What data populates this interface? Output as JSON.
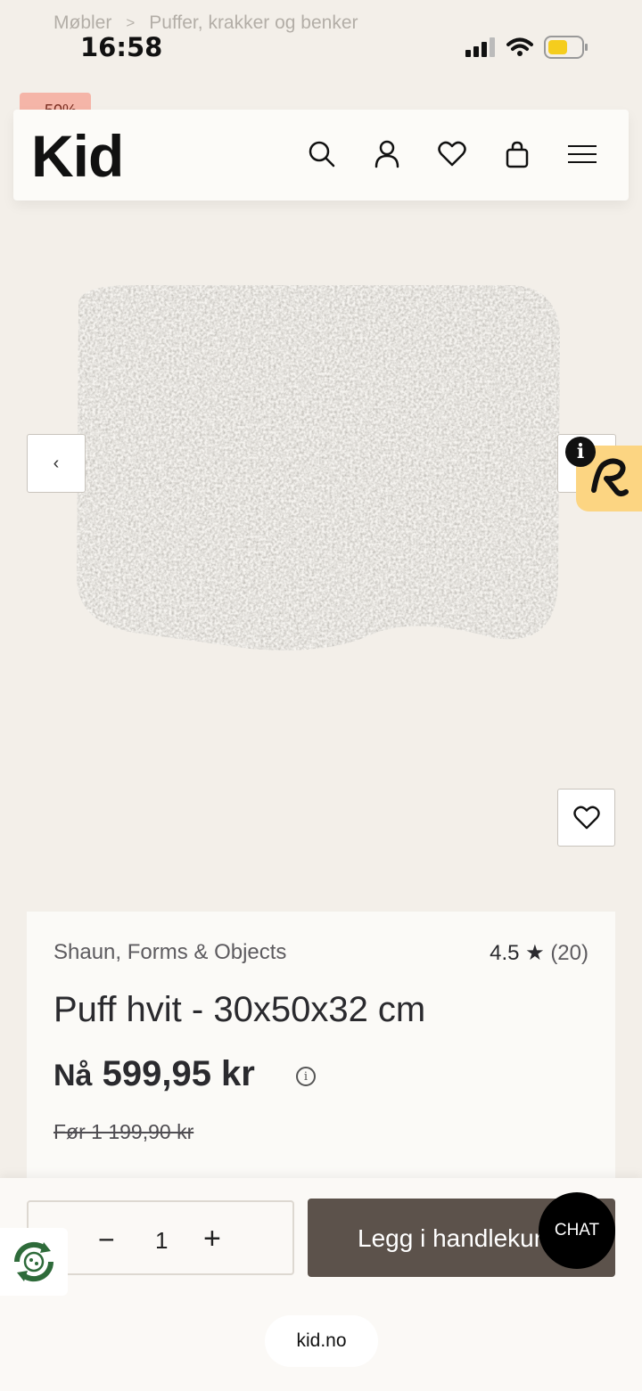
{
  "status_bar": {
    "time": "16:58"
  },
  "breadcrumb": {
    "items": [
      "Møbler",
      "Puffer, krakker og benker"
    ],
    "separator": ">"
  },
  "sale_badge": "-50%",
  "header": {
    "logo": "Kid",
    "icons": [
      "search-icon",
      "account-icon",
      "wishlist-icon",
      "bag-icon",
      "menu-icon"
    ]
  },
  "gallery": {
    "prev_label": "‹"
  },
  "info_badge": "i",
  "product": {
    "brand": "Shaun, Forms & Objects",
    "rating": "4.5 ★",
    "rating_count": "(20)",
    "title": "Puff hvit - 30x50x32 cm",
    "price_prefix": "Nå",
    "price_now": "599,95 kr",
    "price_before": "Før 1 199,90 kr"
  },
  "cart": {
    "quantity": "1",
    "minus": "−",
    "plus": "+",
    "add_to_cart_label": "Legg i handlekurv"
  },
  "chat_label": "CHAT",
  "url": "kid.no",
  "colors": {
    "accent": "#5c524b",
    "background": "#f3efe9",
    "sale": "#f5b5a8",
    "badge": "#fcd582"
  }
}
